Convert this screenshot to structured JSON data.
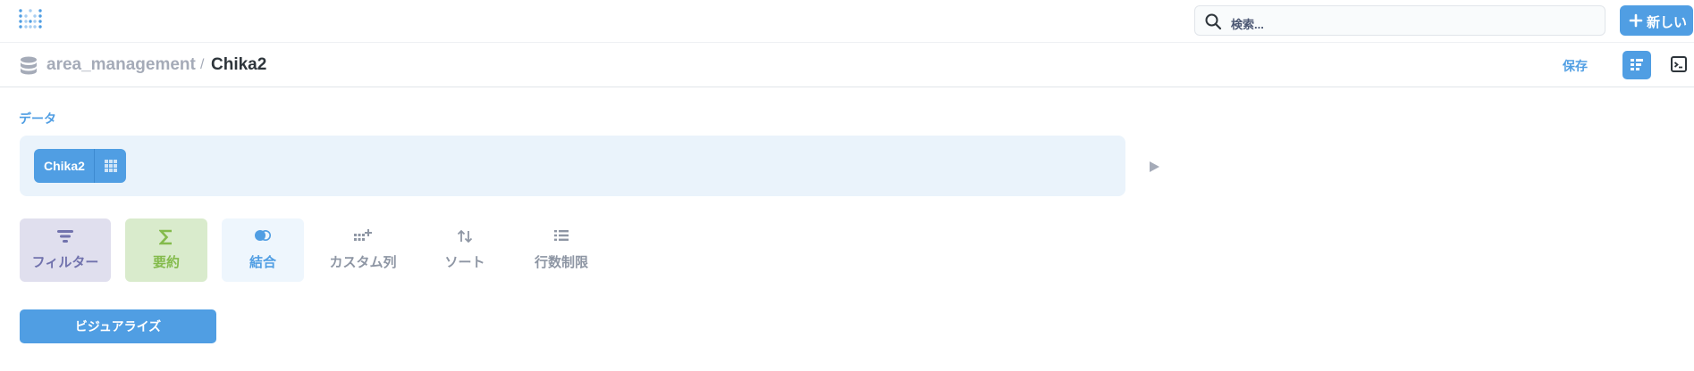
{
  "topnav": {
    "search_placeholder": "検索...",
    "new_button": "新しい"
  },
  "header": {
    "breadcrumb_db": "area_management",
    "breadcrumb_sep": "/",
    "breadcrumb_table": "Chika2",
    "save_button": "保存"
  },
  "editor": {
    "data_label": "データ",
    "source_table": "Chika2",
    "actions": {
      "filter": "フィルター",
      "summarize": "要約",
      "join": "結合",
      "custom_column": "カスタム列",
      "sort": "ソート",
      "limit": "行数制限"
    },
    "visualize_button": "ビジュアライズ"
  },
  "colors": {
    "brand": "#509ee3",
    "filter": "#7172ad",
    "summarize": "#84bb4c",
    "muted": "#8e96a4"
  }
}
